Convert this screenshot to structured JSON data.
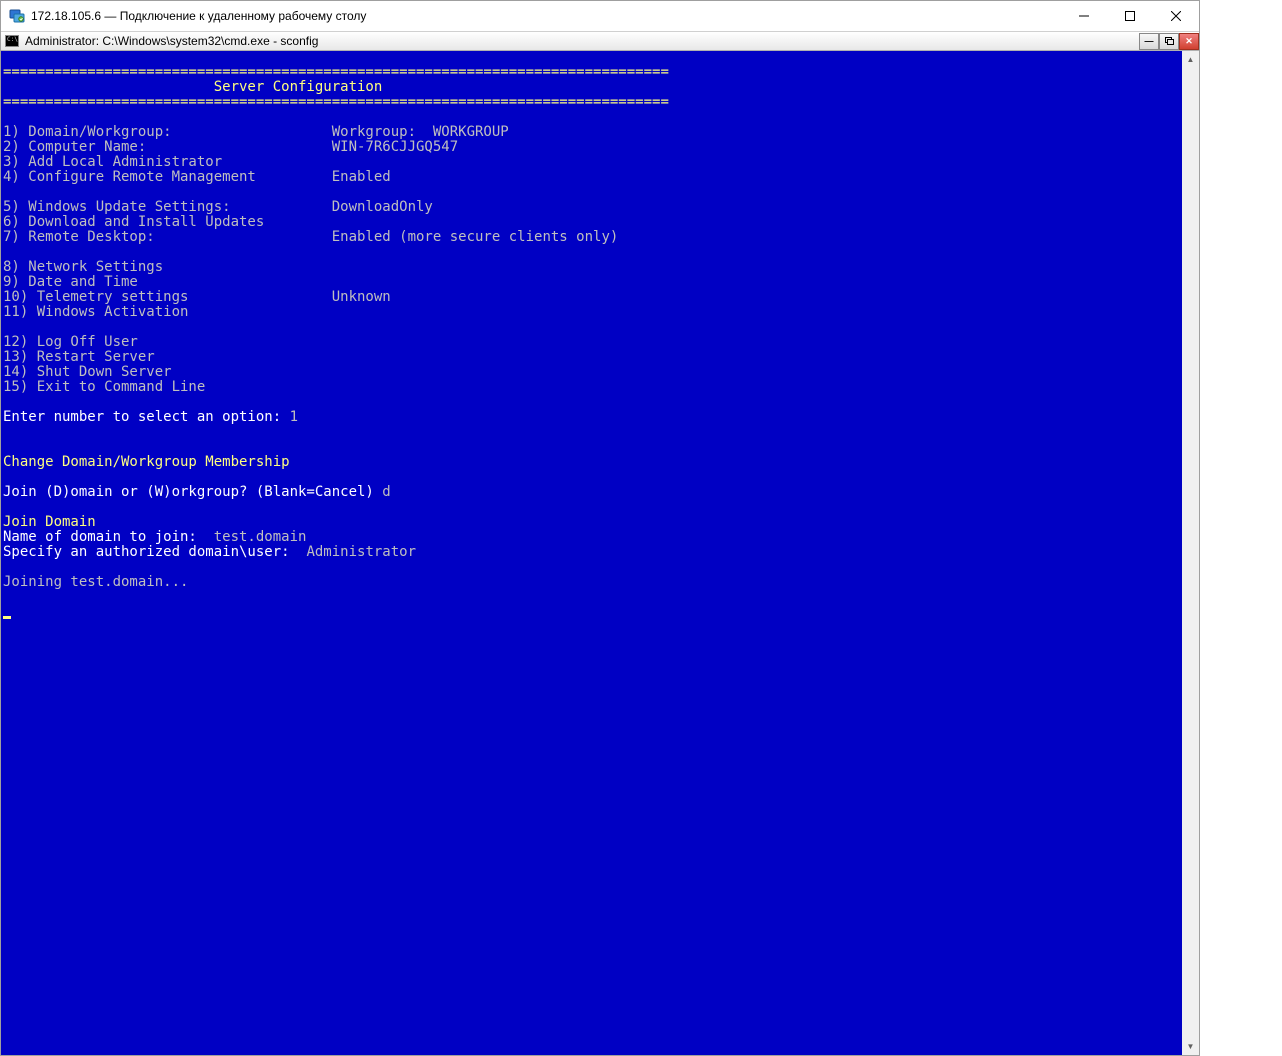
{
  "rdp": {
    "title": "172.18.105.6 — Подключение к удаленному рабочему столу"
  },
  "cmd": {
    "title": "Administrator: C:\\Windows\\system32\\cmd.exe - sconfig"
  },
  "sconfig": {
    "divider": "===============================================================================",
    "header_title": "                         Server Configuration",
    "items": [
      {
        "n": "1",
        "label": "Domain/Workgroup:",
        "value": "Workgroup:  WORKGROUP"
      },
      {
        "n": "2",
        "label": "Computer Name:",
        "value": "WIN-7R6CJJGQ547"
      },
      {
        "n": "3",
        "label": "Add Local Administrator",
        "value": ""
      },
      {
        "n": "4",
        "label": "Configure Remote Management",
        "value": "Enabled"
      },
      {
        "n": "5",
        "label": "Windows Update Settings:",
        "value": "DownloadOnly"
      },
      {
        "n": "6",
        "label": "Download and Install Updates",
        "value": ""
      },
      {
        "n": "7",
        "label": "Remote Desktop:",
        "value": "Enabled (more secure clients only)"
      },
      {
        "n": "8",
        "label": "Network Settings",
        "value": ""
      },
      {
        "n": "9",
        "label": "Date and Time",
        "value": ""
      },
      {
        "n": "10",
        "label": "Telemetry settings",
        "value": "Unknown"
      },
      {
        "n": "11",
        "label": "Windows Activation",
        "value": ""
      },
      {
        "n": "12",
        "label": "Log Off User",
        "value": ""
      },
      {
        "n": "13",
        "label": "Restart Server",
        "value": ""
      },
      {
        "n": "14",
        "label": "Shut Down Server",
        "value": ""
      },
      {
        "n": "15",
        "label": "Exit to Command Line",
        "value": ""
      }
    ],
    "prompt": {
      "text": "Enter number to select an option: ",
      "input": "1"
    },
    "section_title": "Change Domain/Workgroup Membership",
    "join_prompt": {
      "text": "Join (D)omain or (W)orkgroup? (Blank=Cancel) ",
      "input": "d"
    },
    "join_domain_header": "Join Domain",
    "domain_prompt": {
      "text": "Name of domain to join:  ",
      "input": "test.domain"
    },
    "user_prompt": {
      "text": "Specify an authorized domain\\user:  ",
      "input": "Administrator"
    },
    "status": "Joining test.domain..."
  }
}
